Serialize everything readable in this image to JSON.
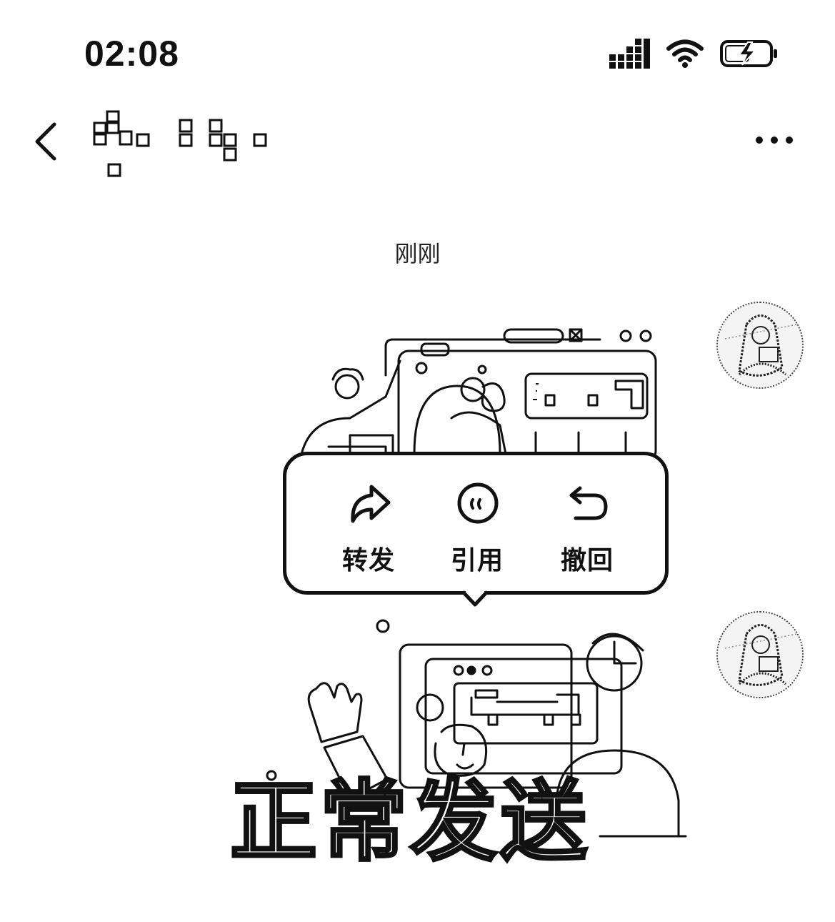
{
  "status_bar": {
    "time": "02:08",
    "icons": [
      "signal-icon",
      "wifi-icon",
      "battery-charging-icon"
    ]
  },
  "header": {
    "back_icon": "chevron-left-icon",
    "more_icon": "more-dots-icon"
  },
  "chat": {
    "timestamp": "刚刚",
    "messages": [
      {
        "type": "image",
        "sender": "self"
      },
      {
        "type": "image",
        "sender": "self",
        "overlay_text": "正常发送"
      }
    ]
  },
  "context_menu": {
    "items": [
      {
        "label": "转发",
        "icon": "forward-arrow-icon"
      },
      {
        "label": "引用",
        "icon": "quote-icon"
      },
      {
        "label": "撤回",
        "icon": "undo-icon"
      }
    ]
  }
}
